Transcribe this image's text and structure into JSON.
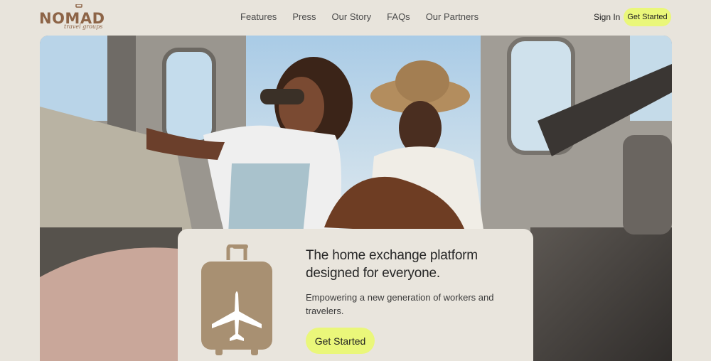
{
  "brand": {
    "logo_text": "NOMAD",
    "logo_tagline": "travel groups"
  },
  "nav": {
    "items": [
      {
        "label": "Features"
      },
      {
        "label": "Press"
      },
      {
        "label": "Our Story"
      },
      {
        "label": "FAQs"
      },
      {
        "label": "Our Partners"
      }
    ]
  },
  "header": {
    "sign_in": "Sign In",
    "get_started": "Get Started"
  },
  "hero": {
    "image_alt_icon": "travel-photo",
    "card": {
      "title": "The home exchange platform designed for everyone.",
      "subtitle": "Empowering a new generation of workers and travelers.",
      "button": "Get Started",
      "icon": "suitcase-airplane-icon"
    }
  },
  "colors": {
    "background": "#e8e4dc",
    "accent": "#eaf77a",
    "brand": "#8d6447",
    "icon": "#a89072"
  }
}
